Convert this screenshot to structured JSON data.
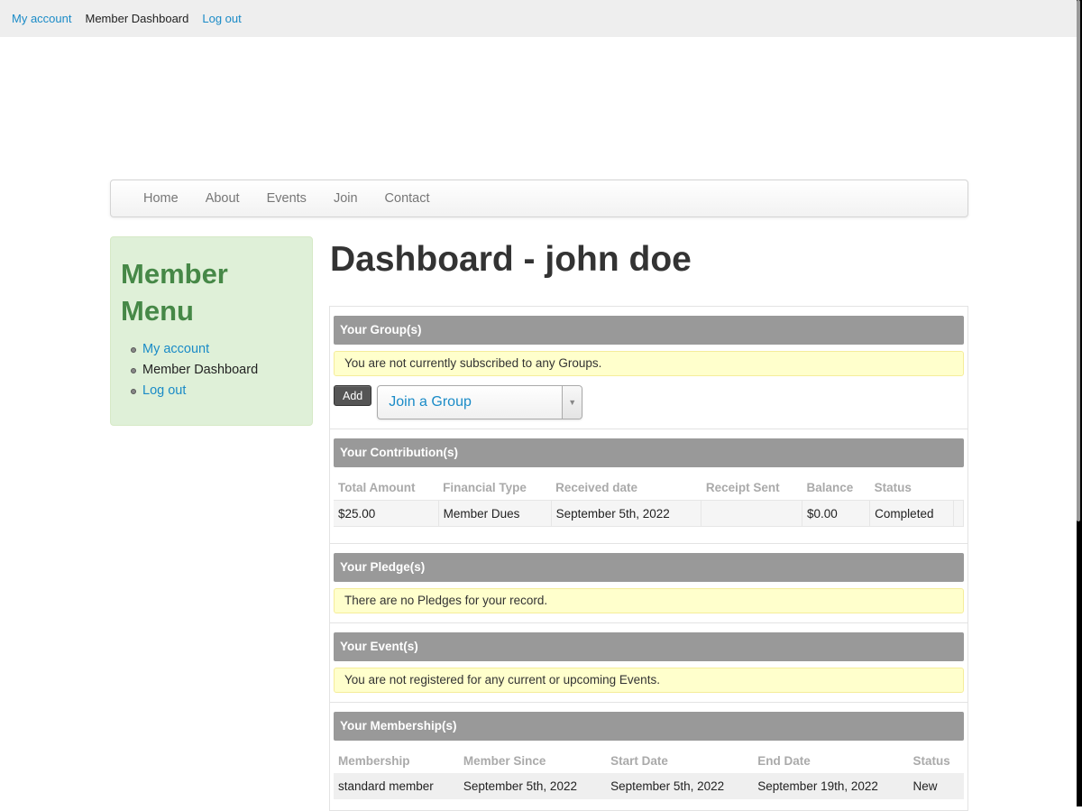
{
  "topbar": {
    "items": [
      {
        "label": "My account",
        "active": false
      },
      {
        "label": "Member Dashboard",
        "active": true
      },
      {
        "label": "Log out",
        "active": false
      }
    ]
  },
  "main_nav": {
    "items": [
      "Home",
      "About",
      "Events",
      "Join",
      "Contact"
    ]
  },
  "sidebar": {
    "title": "Member Menu",
    "items": [
      {
        "label": "My account",
        "link": true
      },
      {
        "label": "Member Dashboard",
        "link": false
      },
      {
        "label": "Log out",
        "link": true
      }
    ]
  },
  "page": {
    "title": "Dashboard - john doe"
  },
  "groups": {
    "header": "Your Group(s)",
    "notice": "You are not currently subscribed to any Groups.",
    "add_label": "Add",
    "select_value": "Join a Group",
    "select_arrow": "▼"
  },
  "contributions": {
    "header": "Your Contribution(s)",
    "columns": [
      "Total Amount",
      "Financial Type",
      "Received date",
      "Receipt Sent",
      "Balance",
      "Status"
    ],
    "rows": [
      [
        "$25.00",
        "Member Dues",
        "September 5th, 2022",
        "",
        "$0.00",
        "Completed"
      ]
    ]
  },
  "pledges": {
    "header": "Your Pledge(s)",
    "notice": "There are no Pledges for your record."
  },
  "events": {
    "header": "Your Event(s)",
    "notice": "You are not registered for any current or upcoming Events."
  },
  "memberships": {
    "header": "Your Membership(s)",
    "columns": [
      "Membership",
      "Member Since",
      "Start Date",
      "End Date",
      "Status"
    ],
    "rows": [
      [
        "standard member",
        "September 5th, 2022",
        "September 5th, 2022",
        "September 19th, 2022",
        "New"
      ]
    ]
  }
}
